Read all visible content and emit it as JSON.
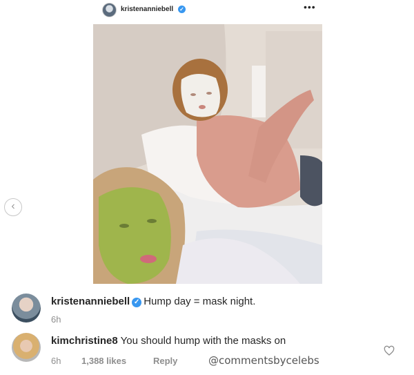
{
  "header": {
    "username": "kristenanniebell",
    "verified_glyph": "✓",
    "more_glyph": "•••",
    "icons": [
      "avatar",
      "verified-badge-icon",
      "more-options-icon"
    ]
  },
  "post": {
    "image_alt": "Selfie in bed wearing sheet face masks"
  },
  "carousel": {
    "prev_glyph": "‹"
  },
  "comments": [
    {
      "username": "kristenanniebell",
      "verified_glyph": "✓",
      "text": "Hump day = mask night.",
      "time": "6h"
    },
    {
      "username": "kimchristine8",
      "text": "You should hump with the masks on",
      "time": "6h",
      "likes": "1,388 likes",
      "reply_label": "Reply"
    }
  ],
  "watermark": "@commentsbycelebs",
  "colors": {
    "verified": "#3897f0",
    "meta": "#8e8e8e",
    "text": "#262626"
  }
}
